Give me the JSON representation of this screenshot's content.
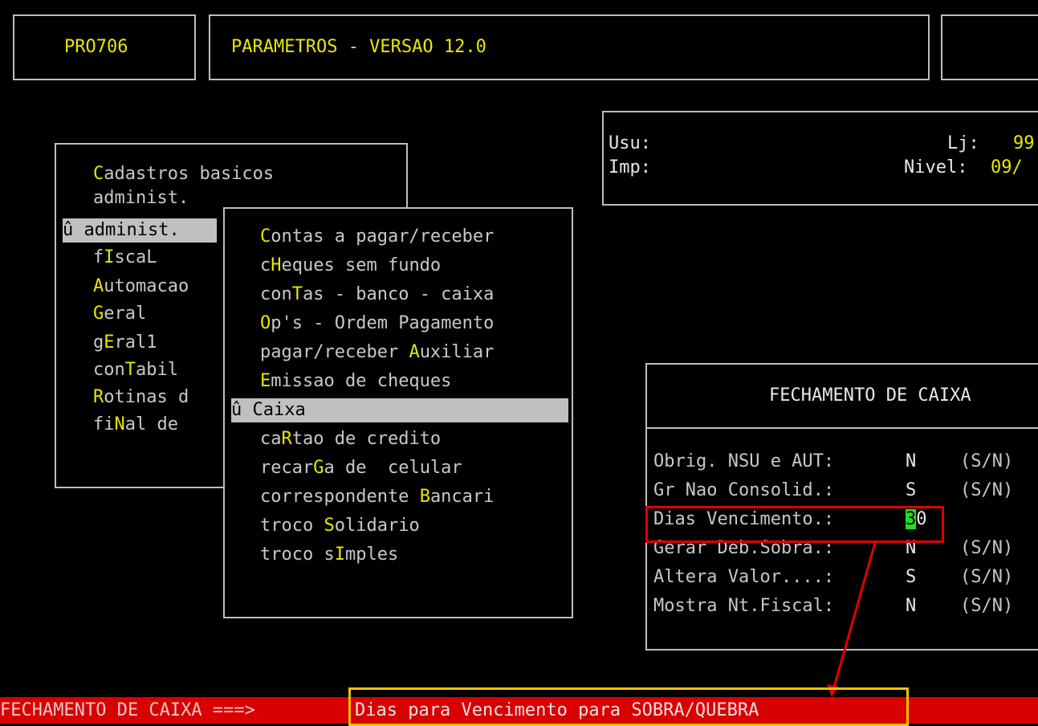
{
  "header": {
    "program": "PRO706",
    "title": "PARAMETROS - VERSAO 12.0"
  },
  "session": {
    "usu_label": "Usu:",
    "imp_label": "Imp:",
    "lj_label": "Lj:",
    "lj_value": "99",
    "nivel_label": "Nivel:",
    "nivel_value": "09/"
  },
  "main_menu": {
    "items": [
      {
        "pre": "",
        "key": "C",
        "post": "adastros basicos"
      },
      {
        "pre": "administ.",
        "key": "",
        "post": ""
      },
      {
        "pre": "û administ.",
        "key": "",
        "post": ""
      },
      {
        "pre": "f",
        "key": "I",
        "post": "scaL"
      },
      {
        "pre": "",
        "key": "A",
        "post": "utomacao"
      },
      {
        "pre": "",
        "key": "G",
        "post": "eral"
      },
      {
        "pre": "g",
        "key": "E",
        "post": "ral1"
      },
      {
        "pre": "con",
        "key": "T",
        "post": "abil"
      },
      {
        "pre": "",
        "key": "R",
        "post": "otinas d"
      },
      {
        "pre": "fi",
        "key": "N",
        "post": "al de"
      }
    ]
  },
  "sub_menu": {
    "items": [
      {
        "pre": "",
        "key": "C",
        "post": "ontas a pagar/receber"
      },
      {
        "pre": "c",
        "key": "H",
        "post": "eques sem fundo"
      },
      {
        "pre": "con",
        "key": "T",
        "post": "as - banco - caixa"
      },
      {
        "pre": "",
        "key": "O",
        "post": "p's - Ordem Pagamento"
      },
      {
        "pre": "pagar/receber ",
        "key": "A",
        "post": "uxiliar"
      },
      {
        "pre": "",
        "key": "E",
        "post": "missao de cheques"
      },
      {
        "pre": "û Caixa",
        "key": "",
        "post": ""
      },
      {
        "pre": "ca",
        "key": "R",
        "post": "tao de credito"
      },
      {
        "pre": "recar",
        "key": "G",
        "post": "a de  celular"
      },
      {
        "pre": "correspondente ",
        "key": "B",
        "post": "ancari"
      },
      {
        "pre": "troco ",
        "key": "S",
        "post": "olidario"
      },
      {
        "pre": "troco s",
        "key": "I",
        "post": "mples"
      }
    ]
  },
  "fechamento": {
    "title": "FECHAMENTO DE CAIXA",
    "fields": [
      {
        "label": "Obrig. NSU e AUT:",
        "value": "N",
        "hint": "(S/N)"
      },
      {
        "label": "Gr Nao Consolid.:",
        "value": "S",
        "hint": "(S/N)"
      },
      {
        "label": "Dias Vencimento.:",
        "value": "30",
        "hint": ""
      },
      {
        "label": "Gerar Deb.Sobra.:",
        "value": "N",
        "hint": "(S/N)"
      },
      {
        "label": "Altera Valor....:",
        "value": "S",
        "hint": "(S/N)"
      },
      {
        "label": "Mostra Nt.Fiscal:",
        "value": "N",
        "hint": "(S/N)"
      }
    ]
  },
  "status_bar": {
    "context": "FECHAMENTO DE CAIXA ===>",
    "message": "Dias para Vencimento para SOBRA/QUEBRA"
  },
  "colors": {
    "background": "#000000",
    "text": "#c8c8c8",
    "hotkey": "#e8e800",
    "selection": "#c0c0c0",
    "status_bar": "#d80000",
    "annotation_red": "#e00000",
    "annotation_yellow": "#f0c000",
    "cursor": "#20e020"
  }
}
